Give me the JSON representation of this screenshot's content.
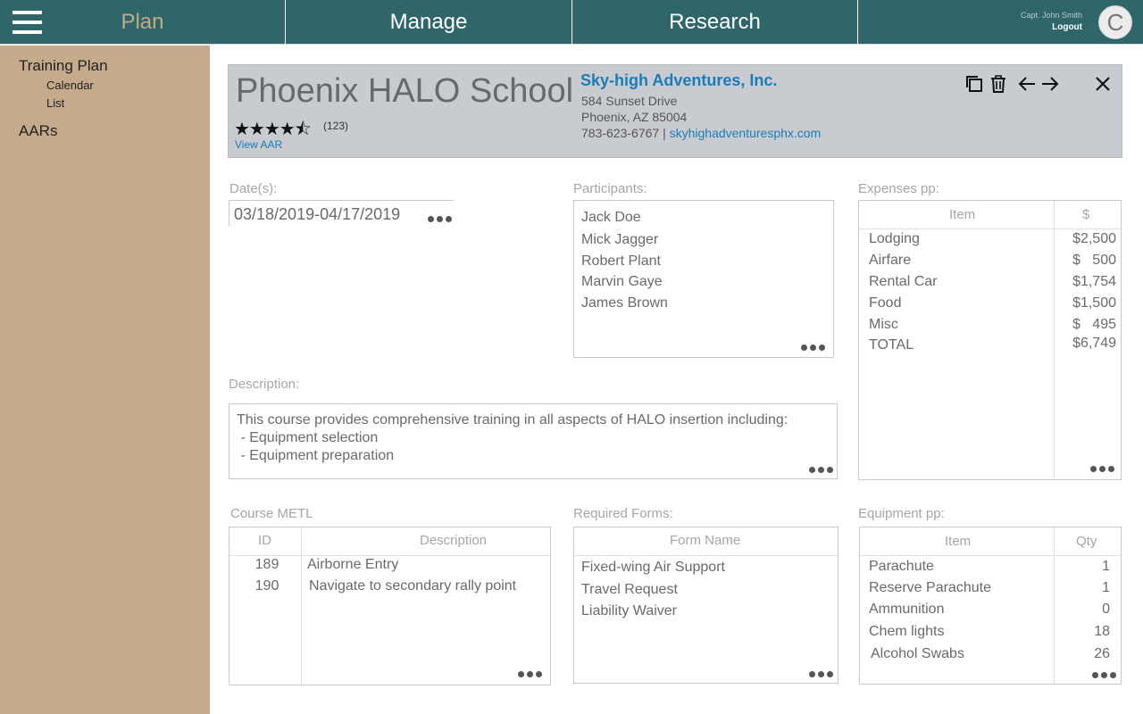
{
  "nav": {
    "plan": "Plan",
    "manage": "Manage",
    "research": "Research",
    "user_name": "Capt. John Smith",
    "logout": "Logout",
    "avatar_initial": "C"
  },
  "sidebar": {
    "items": [
      {
        "label": "Training Plan"
      },
      {
        "label": "Calendar"
      },
      {
        "label": "List"
      },
      {
        "label": "AARs"
      }
    ]
  },
  "header": {
    "title": "Phoenix HALO School",
    "rating": 4.5,
    "stars_display": "★★★★⯪",
    "rating_count": "(123)",
    "view_aar": "View AAR",
    "company_name": "Sky-high Adventures, Inc.",
    "address_line1": "584 Sunset Drive",
    "address_line2": "Phoenix, AZ  85004",
    "phone": "783-623-6767",
    "separator": " | ",
    "website": "skyhighadventuresphx.com"
  },
  "dates": {
    "label": "Date(s):",
    "value": "03/18/2019-04/17/2019"
  },
  "participants": {
    "label": "Participants:",
    "names": [
      "Jack Doe",
      "Mick Jagger",
      "Robert Plant",
      "Marvin Gaye",
      "James Brown"
    ]
  },
  "description": {
    "label": "Description:",
    "lines": [
      "This course provides comprehensive training in all aspects of HALO insertion including:",
      " - Equipment selection",
      " - Equipment preparation"
    ]
  },
  "expenses": {
    "label": "Expenses pp:",
    "col_item": "Item",
    "col_amount": "$",
    "rows": [
      {
        "item": "Lodging",
        "amount": "$2,500"
      },
      {
        "item": "Airfare",
        "amount": "$   500"
      },
      {
        "item": "Rental Car",
        "amount": "$1,754"
      },
      {
        "item": "Food",
        "amount": "$1,500"
      },
      {
        "item": "Misc",
        "amount": "$   495"
      },
      {
        "item": "TOTAL",
        "amount": "$6,749"
      }
    ]
  },
  "metl": {
    "label": "Course METL",
    "col_id": "ID",
    "col_desc": "Description",
    "rows": [
      {
        "id": "189",
        "desc": "Airborne Entry"
      },
      {
        "id": "190",
        "desc": "Navigate to secondary rally point"
      }
    ]
  },
  "forms": {
    "label": "Required Forms:",
    "col_name": "Form Name",
    "items": [
      "Fixed-wing Air Support",
      "Travel Request",
      "Liability Waiver"
    ]
  },
  "equipment": {
    "label": "Equipment pp:",
    "col_item": "Item",
    "col_qty": "Qty",
    "rows": [
      {
        "item": "Parachute",
        "qty": "1"
      },
      {
        "item": "Reserve Parachute",
        "qty": "1"
      },
      {
        "item": "Ammunition",
        "qty": "0"
      },
      {
        "item": "Chem lights",
        "qty": "18"
      },
      {
        "item": "Alcohol Swabs",
        "qty": "26"
      }
    ]
  },
  "colors": {
    "nav_bg": "#2e6669",
    "nav_active": "#c5aa86",
    "sidebar_bg": "#c5aa8b",
    "header_bg": "#c8ccd1",
    "link": "#1b7cb8"
  }
}
